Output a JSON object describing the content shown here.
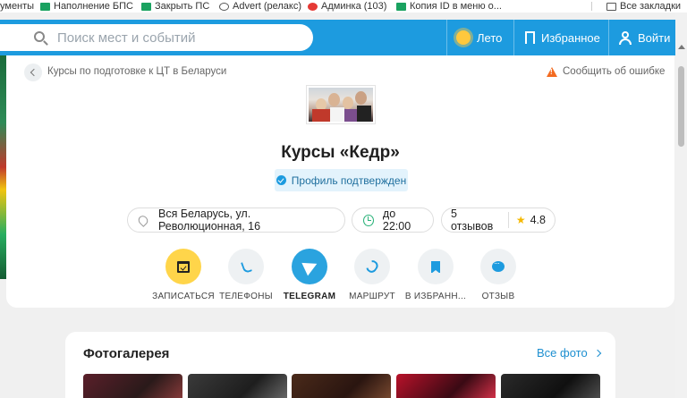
{
  "bookmarks": [
    {
      "label": "ументы",
      "icon": "none-icon"
    },
    {
      "label": "Наполнение БПС",
      "icon": "sheets-icon"
    },
    {
      "label": "Закрыть ПС",
      "icon": "sheets-icon"
    },
    {
      "label": "Advert (релакс)",
      "icon": "globe-icon"
    },
    {
      "label": "Админка (103)",
      "icon": "red-circle-icon"
    },
    {
      "label": "Копия ID в меню о...",
      "icon": "sheets-icon"
    },
    {
      "label": "Все закладки",
      "icon": "folder-icon"
    }
  ],
  "header": {
    "search_placeholder": "Поиск мест и событий",
    "season_label": "Лето",
    "favorites_label": "Избранное",
    "login_label": "Войти",
    "accent_color": "#1d9bdf"
  },
  "profile": {
    "breadcrumb": "Курсы по подготовке к ЦТ в Беларуси",
    "report_label": "Сообщить об ошибке",
    "title": "Курсы «Кедр»",
    "verified_label": "Профиль подтвержден",
    "address": "Вся Беларусь, ул. Революционная, 16",
    "hours": "до 22:00",
    "reviews_count": "5 отзывов",
    "rating": "4.8"
  },
  "actions": [
    {
      "label": "ЗАПИСАТЬСЯ",
      "icon": "calendar-check-icon"
    },
    {
      "label": "ТЕЛЕФОНЫ",
      "icon": "phone-icon"
    },
    {
      "label": "TELEGRAM",
      "icon": "telegram-icon"
    },
    {
      "label": "МАРШРУТ",
      "icon": "route-icon"
    },
    {
      "label": "В ИЗБРАНН...",
      "icon": "bookmark-icon"
    },
    {
      "label": "ОТЗЫВ",
      "icon": "chat-icon"
    }
  ],
  "gallery": {
    "title": "Фотогалерея",
    "all_label": "Все фото"
  }
}
